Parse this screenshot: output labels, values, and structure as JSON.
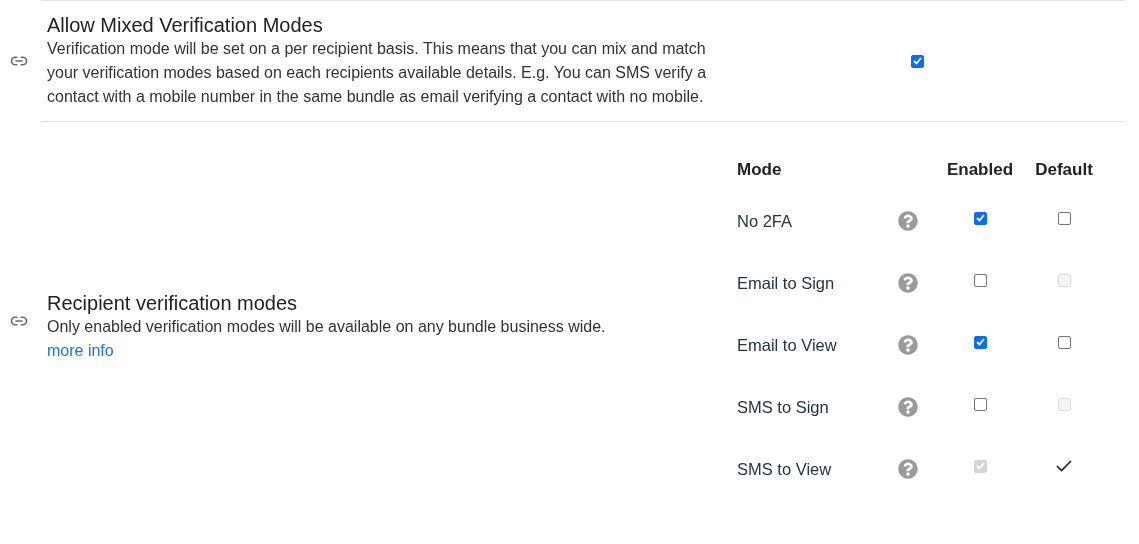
{
  "settings": [
    {
      "kind": "toggle",
      "title": "Allow Mixed Verification Modes",
      "description": "Verification mode will be set on a per recipient basis. This means that you can mix and match your verification modes based on each recipients available details. E.g. You can SMS verify a contact with a mobile number in the same bundle as email verifying a contact with no mobile.",
      "checked": true
    },
    {
      "kind": "table",
      "title": "Recipient verification modes",
      "description": "Only enabled verification modes will be available on any bundle business wide.",
      "link": "more info",
      "columns": [
        "Mode",
        "Enabled",
        "Default"
      ],
      "rows": [
        {
          "mode": "No 2FA",
          "enabled": {
            "kind": "checkbox",
            "checked": true,
            "disabled": false
          },
          "default": {
            "kind": "checkbox",
            "checked": false,
            "disabled": false
          }
        },
        {
          "mode": "Email to Sign",
          "enabled": {
            "kind": "checkbox",
            "checked": false,
            "disabled": false
          },
          "default": {
            "kind": "checkbox",
            "checked": false,
            "disabled": true
          }
        },
        {
          "mode": "Email to View",
          "enabled": {
            "kind": "checkbox",
            "checked": true,
            "disabled": false
          },
          "default": {
            "kind": "checkbox",
            "checked": false,
            "disabled": false
          }
        },
        {
          "mode": "SMS to Sign",
          "enabled": {
            "kind": "checkbox",
            "checked": false,
            "disabled": false
          },
          "default": {
            "kind": "checkbox",
            "checked": false,
            "disabled": true
          }
        },
        {
          "mode": "SMS to View",
          "enabled": {
            "kind": "checkbox",
            "checked": true,
            "disabled": true
          },
          "default": {
            "kind": "tick",
            "checked": true,
            "disabled": false
          }
        }
      ]
    }
  ]
}
